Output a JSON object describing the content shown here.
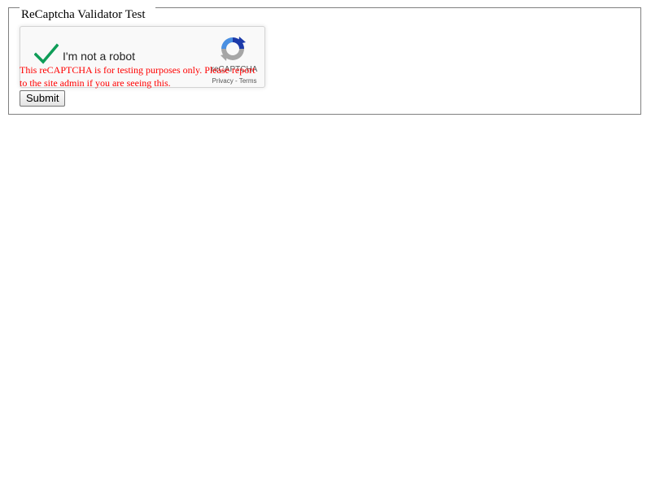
{
  "form": {
    "legend": "ReCaptcha Validator Test",
    "submit_label": "Submit"
  },
  "recaptcha": {
    "checked": true,
    "label": "I'm not a robot",
    "brand": "reCAPTCHA",
    "privacy_link": "Privacy",
    "separator": " - ",
    "terms_link": "Terms",
    "check_color": "#0f9d58",
    "warning_text": "This reCAPTCHA is for testing purposes only. Please report to the site admin if you are seeing this.",
    "warning_color": "#ff0000"
  },
  "icons": {
    "check": "checkmark-icon",
    "logo": "recaptcha-logo-icon"
  }
}
